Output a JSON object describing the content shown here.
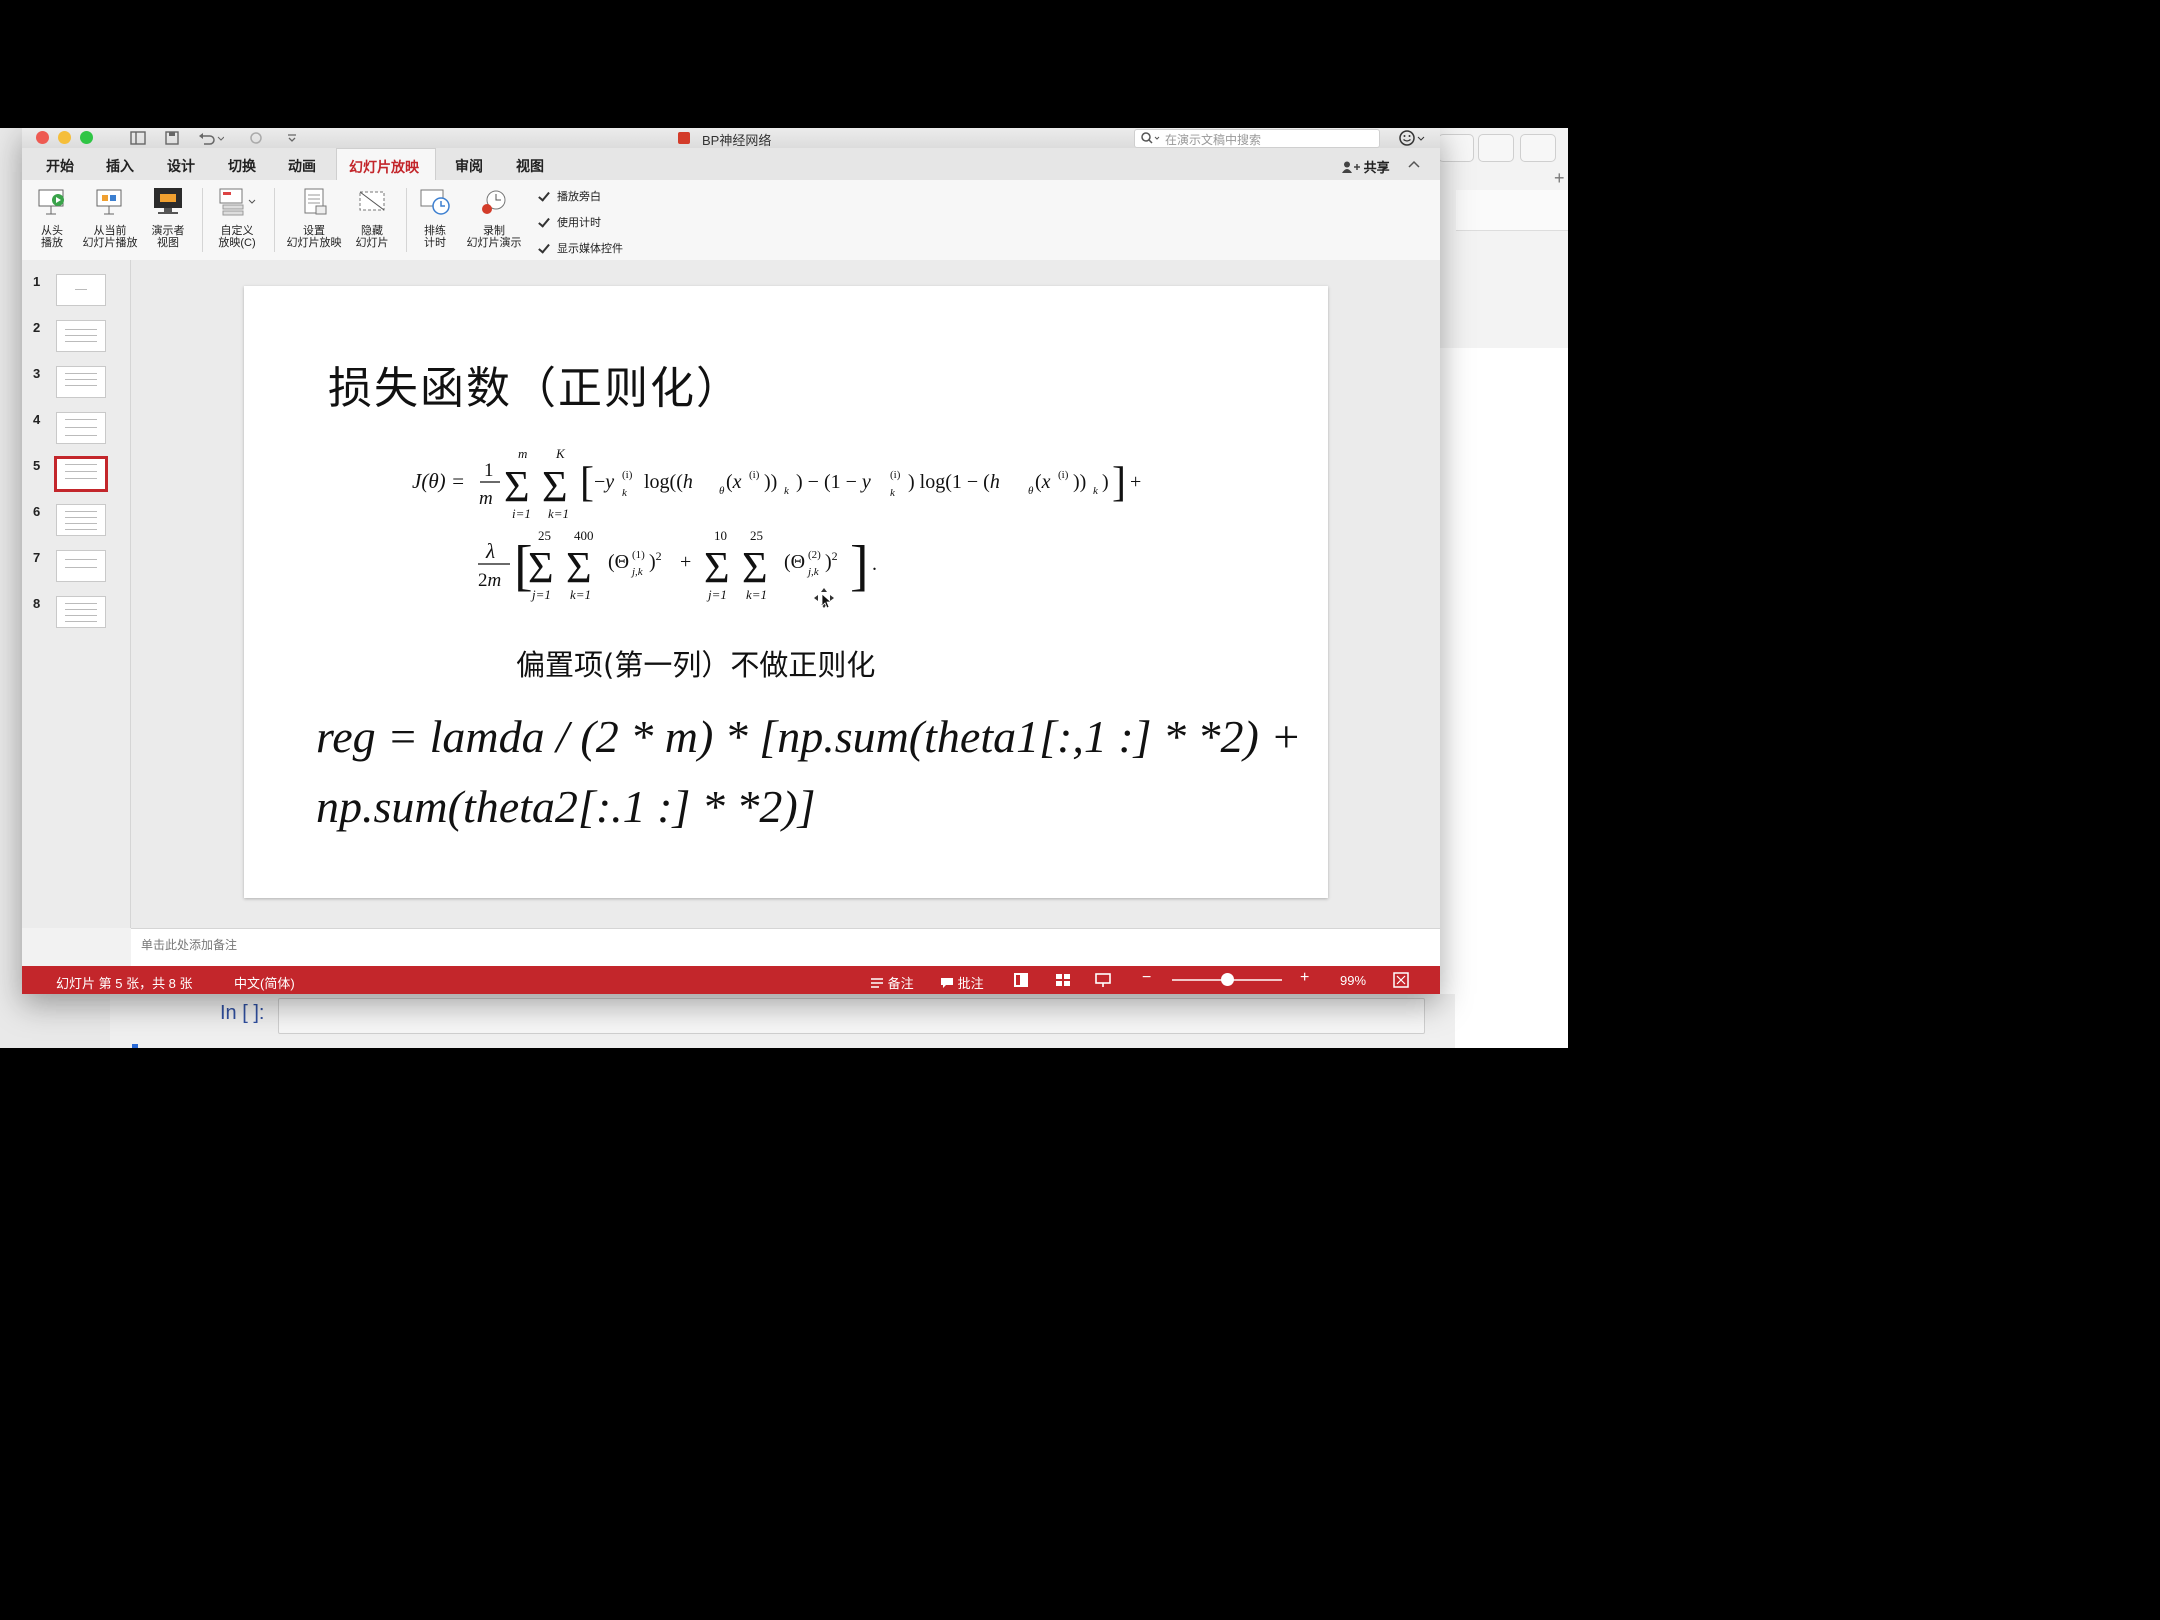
{
  "window": {
    "title": "BP神经网络",
    "search_placeholder": "在演示文稿中搜索",
    "share_label": "共享"
  },
  "tabs": [
    "开始",
    "插入",
    "设计",
    "切换",
    "动画",
    "幻灯片放映",
    "审阅",
    "视图"
  ],
  "ribbon": {
    "buttons": [
      {
        "l1": "从头",
        "l2": "播放"
      },
      {
        "l1": "从当前",
        "l2": "幻灯片播放"
      },
      {
        "l1": "演示者",
        "l2": "视图"
      },
      {
        "l1": "自定义",
        "l2": "放映(C)"
      },
      {
        "l1": "设置",
        "l2": "幻灯片放映"
      },
      {
        "l1": "隐藏",
        "l2": "幻灯片"
      },
      {
        "l1": "排练",
        "l2": "计时"
      },
      {
        "l1": "录制",
        "l2": "幻灯片演示"
      }
    ],
    "checks": [
      "播放旁白",
      "使用计时",
      "显示媒体控件"
    ]
  },
  "thumbnails": {
    "numbers": [
      "1",
      "2",
      "3",
      "4",
      "5",
      "6",
      "7",
      "8"
    ],
    "selected": "5"
  },
  "slide": {
    "title": "损失函数（正则化）",
    "note": "偏置项(第一列）不做正则化",
    "code_line1": "reg = lamda / (2 * m) * [np.sum(theta1[:,1 :] * *2) +",
    "code_line2": "np.sum(theta2[:.1 :] * *2)]"
  },
  "notes_placeholder": "单击此处添加备注",
  "status": {
    "slide_info": "幻灯片 第 5 张，共 8 张",
    "language": "中文(简体)",
    "notes_btn": "备注",
    "comments_btn": "批注",
    "zoom": "99%",
    "zoom_level_fraction": 0.5
  },
  "background_app": {
    "prompt": "In [ ]:"
  },
  "colors": {
    "accent_red": "#c3262b"
  }
}
